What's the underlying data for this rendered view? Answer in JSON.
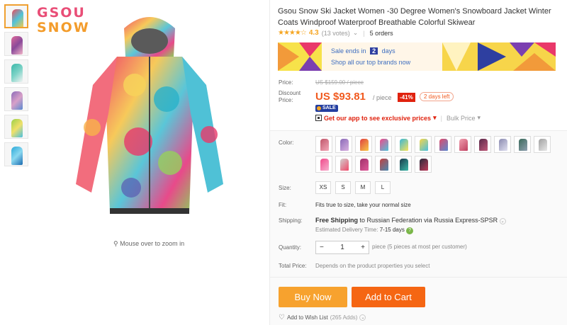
{
  "brand": {
    "line1": "GSOU",
    "line2": "SNOW"
  },
  "zoom_hint": "Mouse over to zoom in",
  "product": {
    "title": "Gsou Snow Ski Jacket Women -30 Degree Women's Snowboard Jacket Winter Coats Windproof Waterproof Breathable Colorful Skiwear",
    "rating": "4.3",
    "votes": "(13 votes)",
    "orders": "5 orders"
  },
  "banner": {
    "sale_ends_prefix": "Sale ends in",
    "days_count": "2",
    "days_label": "days",
    "cta": "Shop all our top brands now"
  },
  "price": {
    "label": "Price:",
    "old": "US $159.00 / piece",
    "discount_label_1": "Discount",
    "discount_label_2": "Price:",
    "new": "US $93.81",
    "per": "/ piece",
    "off": "-41%",
    "days_left": "2 days left",
    "sale_badge": "SALE",
    "app_text": "Get our app to see exclusive prices",
    "bulk": "Bulk Price"
  },
  "labels": {
    "color": "Color:",
    "size": "Size:",
    "fit": "Fit:",
    "shipping": "Shipping:",
    "quantity": "Quantity:",
    "total": "Total Price:"
  },
  "sizes": [
    "XS",
    "S",
    "M",
    "L"
  ],
  "fit_text": "Fits true to size, take your normal size",
  "shipping": {
    "free": "Free Shipping",
    "to": "to Russian Federation via Russia Express-SPSR",
    "eta_label": "Estimated Delivery Time:",
    "eta": "7-15 days"
  },
  "quantity": {
    "minus": "−",
    "value": "1",
    "plus": "+",
    "note": "piece (5 pieces at most per customer)"
  },
  "total_text": "Depends on the product properties you select",
  "buttons": {
    "buy": "Buy Now",
    "cart": "Add to Cart"
  },
  "wishlist": {
    "label": "Add to Wish List",
    "count": "(265 Adds)"
  },
  "colors": {
    "accent": "#f15a1f",
    "buy": "#f7a22e",
    "cart": "#f56613",
    "rating": "#f5a623"
  }
}
